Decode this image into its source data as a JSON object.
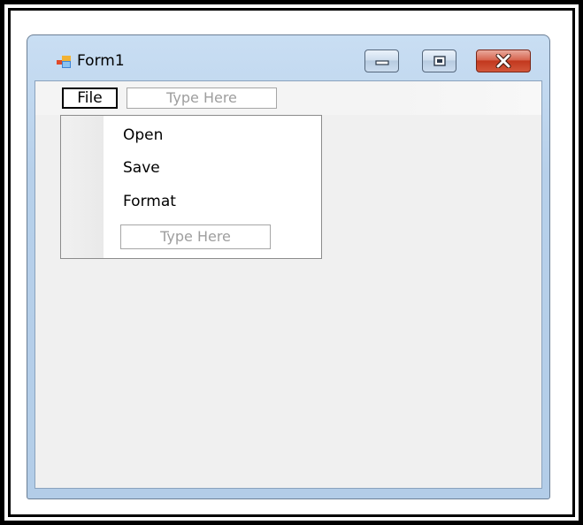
{
  "window": {
    "title": "Form1",
    "icon": "windows-form-icon",
    "caption_buttons": [
      "minimize-icon",
      "maximize-icon",
      "close-icon"
    ],
    "colors": {
      "frame": "#b7d0ea",
      "close": "#c7452a",
      "client": "#f0f0f0"
    }
  },
  "menubar": {
    "file_label": "File",
    "typehere_label": "Type Here"
  },
  "dropdown": {
    "items": [
      {
        "label": "Open"
      },
      {
        "label": "Save"
      },
      {
        "label": "Format"
      }
    ],
    "typehere_label": "Type Here"
  }
}
